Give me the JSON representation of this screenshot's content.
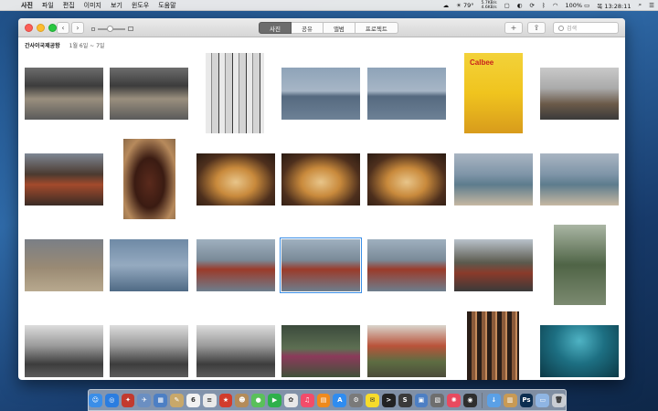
{
  "menubar": {
    "apple": "",
    "items": [
      {
        "label": "사진",
        "bold": true
      },
      {
        "label": "파일"
      },
      {
        "label": "편집"
      },
      {
        "label": "이미지"
      },
      {
        "label": "보기"
      },
      {
        "label": "윈도우"
      },
      {
        "label": "도움말"
      }
    ],
    "temperature": "79°",
    "net_up": "5.7KB/s",
    "net_down": "4.6KB/s",
    "battery": "100%",
    "clock": "목 13:28:11"
  },
  "toolbar": {
    "back": "‹",
    "forward": "›",
    "tabs": [
      {
        "label": "사진",
        "active": true
      },
      {
        "label": "공유",
        "active": false
      },
      {
        "label": "앨범",
        "active": false
      },
      {
        "label": "프로젝트",
        "active": false
      }
    ],
    "add": "+",
    "share": "⇪",
    "search_placeholder": "검색"
  },
  "moment": {
    "location": "간사이국제공항",
    "dates": "1월 6일 ~ 7일"
  },
  "photos": [
    {
      "id": "p1",
      "kind": "station"
    },
    {
      "id": "p2",
      "kind": "station"
    },
    {
      "id": "p3",
      "kind": "manga"
    },
    {
      "id": "p4",
      "kind": "mist-sea"
    },
    {
      "id": "p5",
      "kind": "mist-sea"
    },
    {
      "id": "p6",
      "kind": "chips",
      "text": "Calbee"
    },
    {
      "id": "p7",
      "kind": "street"
    },
    {
      "id": "p8",
      "kind": "tram"
    },
    {
      "id": "p9",
      "kind": "bottle"
    },
    {
      "id": "p10",
      "kind": "food"
    },
    {
      "id": "p11",
      "kind": "food"
    },
    {
      "id": "p12",
      "kind": "food"
    },
    {
      "id": "p13",
      "kind": "coast"
    },
    {
      "id": "p14",
      "kind": "coast"
    },
    {
      "id": "p15",
      "kind": "deer"
    },
    {
      "id": "p16",
      "kind": "torii"
    },
    {
      "id": "p17",
      "kind": "shrine"
    },
    {
      "id": "p18",
      "kind": "shrine",
      "selected": true
    },
    {
      "id": "p19",
      "kind": "shrine"
    },
    {
      "id": "p20",
      "kind": "temple"
    },
    {
      "id": "p21",
      "kind": "monument"
    },
    {
      "id": "p22",
      "kind": "gray-trees"
    },
    {
      "id": "p23",
      "kind": "gray-trees"
    },
    {
      "id": "p24",
      "kind": "gray-trees"
    },
    {
      "id": "p25",
      "kind": "garden"
    },
    {
      "id": "p26",
      "kind": "autumn"
    },
    {
      "id": "p27",
      "kind": "plate"
    },
    {
      "id": "p28",
      "kind": "ropes"
    },
    {
      "id": "p29",
      "kind": "aquarium"
    }
  ],
  "dock": [
    {
      "name": "finder-icon",
      "color": "#3b8ee8",
      "glyph": "☺"
    },
    {
      "name": "safari-icon",
      "color": "#2b7de0",
      "glyph": "◎"
    },
    {
      "name": "rocket-icon",
      "color": "#c23a2e",
      "glyph": "✦"
    },
    {
      "name": "mail-icon",
      "color": "#6b8fc2",
      "glyph": "✈"
    },
    {
      "name": "photos-preview-icon",
      "color": "#4d7fc4",
      "glyph": "▦"
    },
    {
      "name": "notes-icon",
      "color": "#c8a86a",
      "glyph": "✎"
    },
    {
      "name": "calendar-icon",
      "color": "#f2f2f2",
      "glyph": "6"
    },
    {
      "name": "reminders-icon",
      "color": "#e9e9e9",
      "glyph": "≡"
    },
    {
      "name": "star-app-icon",
      "color": "#d23c2c",
      "glyph": "★"
    },
    {
      "name": "contacts-icon",
      "color": "#b38b5a",
      "glyph": "☻"
    },
    {
      "name": "messages-icon",
      "color": "#5ac05a",
      "glyph": "●"
    },
    {
      "name": "facetime-icon",
      "color": "#2eb04a",
      "glyph": "▶"
    },
    {
      "name": "photos-icon",
      "color": "#e8e8e8",
      "glyph": "✿"
    },
    {
      "name": "music-icon",
      "color": "#f24c6a",
      "glyph": "♫"
    },
    {
      "name": "books-icon",
      "color": "#f08a1c",
      "glyph": "▤"
    },
    {
      "name": "appstore-icon",
      "color": "#2f8cf0",
      "glyph": "A"
    },
    {
      "name": "system-prefs-icon",
      "color": "#7a7a7a",
      "glyph": "⚙"
    },
    {
      "name": "kakaotalk-icon",
      "color": "#f7dc2b",
      "glyph": "✉"
    },
    {
      "name": "terminal-icon",
      "color": "#222222",
      "glyph": ">"
    },
    {
      "name": "sublime-icon",
      "color": "#3a3a3a",
      "glyph": "S"
    },
    {
      "name": "preview-icon",
      "color": "#4d7fc4",
      "glyph": "▣"
    },
    {
      "name": "image-app-icon",
      "color": "#6e6e6e",
      "glyph": "▧"
    },
    {
      "name": "color-app-icon",
      "color": "#e84a5f",
      "glyph": "✺"
    },
    {
      "name": "quicktime-icon",
      "color": "#2e2e2e",
      "glyph": "◉"
    },
    {
      "name": "separator"
    },
    {
      "name": "downloads-folder-icon",
      "color": "#5aa0e6",
      "glyph": "↓"
    },
    {
      "name": "archive-icon",
      "color": "#c89a55",
      "glyph": "▥"
    },
    {
      "name": "photoshop-icon",
      "color": "#0c2e50",
      "glyph": "Ps"
    },
    {
      "name": "documents-folder-icon",
      "color": "#8fb5e3",
      "glyph": "▭"
    },
    {
      "name": "trash-icon",
      "color": "#c9cdd3",
      "glyph": "🗑"
    }
  ]
}
